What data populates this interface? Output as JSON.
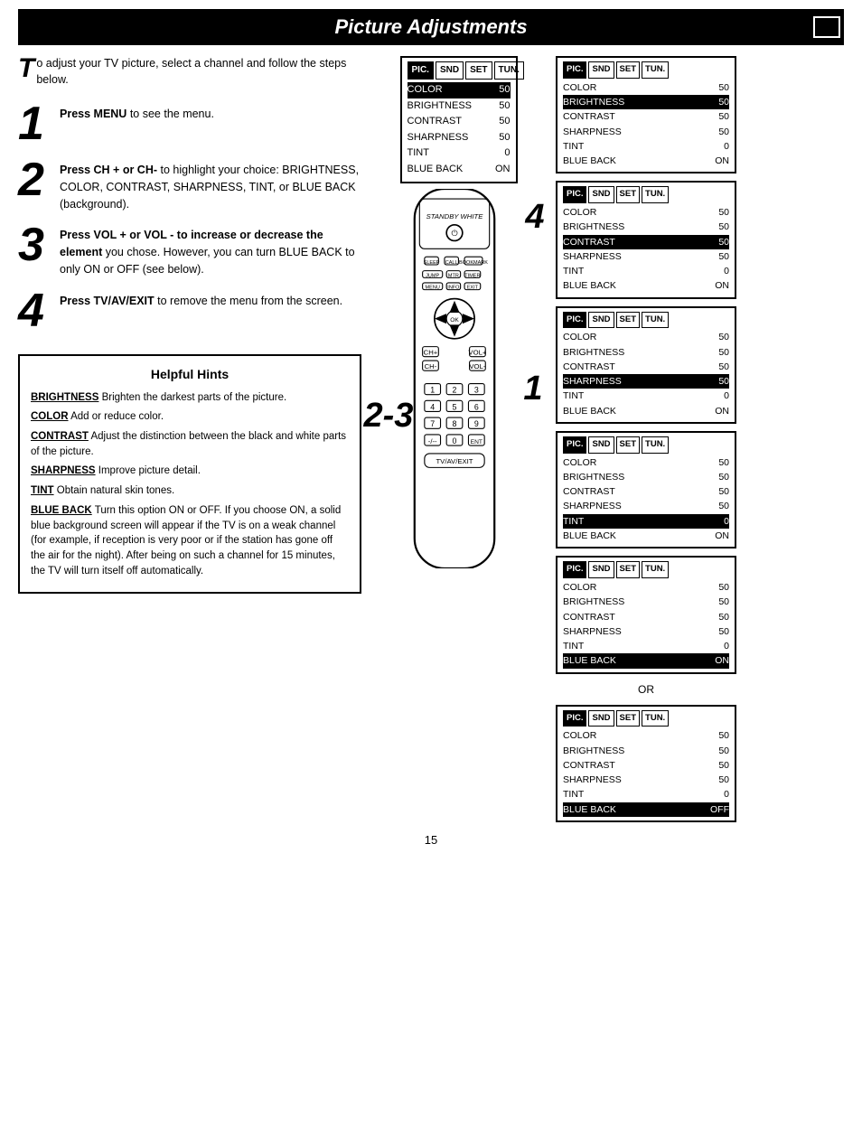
{
  "header": {
    "title": "Picture Adjustments"
  },
  "intro": {
    "text": "o adjust your TV picture, select a channel and follow the steps below."
  },
  "steps": [
    {
      "number": "1",
      "text_parts": [
        {
          "bold": true,
          "text": "Press MENU"
        },
        {
          "bold": false,
          "text": " to see the menu."
        }
      ]
    },
    {
      "number": "2",
      "text_parts": [
        {
          "bold": true,
          "text": "Press CH + or CH-"
        },
        {
          "bold": false,
          "text": " to highlight your choice: BRIGHTNESS, COLOR, CONTRAST, SHARPNESS, TINT, or BLUE BACK (background)."
        }
      ]
    },
    {
      "number": "3",
      "text_parts": [
        {
          "bold": true,
          "text": "Press VOL + or VOL - to increase or decrease the element"
        },
        {
          "bold": false,
          "text": " you chose. However, you can turn BLUE BACK to only ON or OFF (see below)."
        }
      ]
    },
    {
      "number": "4",
      "text_parts": [
        {
          "bold": true,
          "text": "Press TV/AV/EXIT"
        },
        {
          "bold": false,
          "text": " to remove the menu from the screen."
        }
      ]
    }
  ],
  "helpful_hints": {
    "title": "Helpful Hints",
    "items": [
      {
        "label": "BRIGHTNESS",
        "text": " Brighten the darkest parts of the picture."
      },
      {
        "label": "COLOR",
        "text": " Add or reduce color."
      },
      {
        "label": "CONTRAST",
        "text": " Adjust the distinction between the black and white parts of the picture."
      },
      {
        "label": "SHARPNESS",
        "text": " Improve picture detail."
      },
      {
        "label": "TINT",
        "text": " Obtain natural skin tones."
      },
      {
        "label": "BLUE BACK",
        "text": " Turn this option ON or OFF. If you choose ON, a solid blue background screen will appear if the TV is on a weak channel (for example, if reception is very poor or if the station has gone off the air for the night). After being on such a channel for 15 minutes, the TV will turn itself off automatically."
      }
    ]
  },
  "main_screen": {
    "tabs": [
      "PIC.",
      "SND",
      "SET",
      "TUN."
    ],
    "active_tab": 0,
    "rows": [
      {
        "label": "COLOR",
        "value": "50",
        "highlighted": true
      },
      {
        "label": "BRIGHTNESS",
        "value": "50",
        "highlighted": false
      },
      {
        "label": "CONTRAST",
        "value": "50",
        "highlighted": false
      },
      {
        "label": "SHARPNESS",
        "value": "50",
        "highlighted": false
      },
      {
        "label": "TINT",
        "value": "0",
        "highlighted": false
      },
      {
        "label": "BLUE BACK",
        "value": "ON",
        "highlighted": false
      }
    ]
  },
  "side_screens": [
    {
      "tabs": [
        "PIC.",
        "SND",
        "SET",
        "TUN."
      ],
      "active_tab": 0,
      "rows": [
        {
          "label": "COLOR",
          "value": "50",
          "highlighted": false
        },
        {
          "label": "BRIGHTNESS",
          "value": "50",
          "highlighted": true
        },
        {
          "label": "CONTRAST",
          "value": "50",
          "highlighted": false
        },
        {
          "label": "SHARPNESS",
          "value": "50",
          "highlighted": false
        },
        {
          "label": "TINT",
          "value": "0",
          "highlighted": false
        },
        {
          "label": "BLUE BACK",
          "value": "ON",
          "highlighted": false
        }
      ]
    },
    {
      "tabs": [
        "PIC.",
        "SND",
        "SET",
        "TUN."
      ],
      "active_tab": 0,
      "rows": [
        {
          "label": "COLOR",
          "value": "50",
          "highlighted": false
        },
        {
          "label": "BRIGHTNESS",
          "value": "50",
          "highlighted": false
        },
        {
          "label": "CONTRAST",
          "value": "50",
          "highlighted": true
        },
        {
          "label": "SHARPNESS",
          "value": "50",
          "highlighted": false
        },
        {
          "label": "TINT",
          "value": "0",
          "highlighted": false
        },
        {
          "label": "BLUE BACK",
          "value": "ON",
          "highlighted": false
        }
      ]
    },
    {
      "tabs": [
        "PIC.",
        "SND",
        "SET",
        "TUN."
      ],
      "active_tab": 0,
      "rows": [
        {
          "label": "COLOR",
          "value": "50",
          "highlighted": false
        },
        {
          "label": "BRIGHTNESS",
          "value": "50",
          "highlighted": false
        },
        {
          "label": "CONTRAST",
          "value": "50",
          "highlighted": false
        },
        {
          "label": "SHARPNESS",
          "value": "50",
          "highlighted": true
        },
        {
          "label": "TINT",
          "value": "0",
          "highlighted": false
        },
        {
          "label": "BLUE BACK",
          "value": "ON",
          "highlighted": false
        }
      ]
    },
    {
      "tabs": [
        "PIC.",
        "SND",
        "SET",
        "TUN."
      ],
      "active_tab": 0,
      "rows": [
        {
          "label": "COLOR",
          "value": "50",
          "highlighted": false
        },
        {
          "label": "BRIGHTNESS",
          "value": "50",
          "highlighted": false
        },
        {
          "label": "CONTRAST",
          "value": "50",
          "highlighted": false
        },
        {
          "label": "SHARPNESS",
          "value": "50",
          "highlighted": false
        },
        {
          "label": "TINT",
          "value": "0",
          "highlighted": true
        },
        {
          "label": "BLUE BACK",
          "value": "ON",
          "highlighted": false
        }
      ]
    },
    {
      "tabs": [
        "PIC.",
        "SND",
        "SET",
        "TUN."
      ],
      "active_tab": 0,
      "rows": [
        {
          "label": "COLOR",
          "value": "50",
          "highlighted": false
        },
        {
          "label": "BRIGHTNESS",
          "value": "50",
          "highlighted": false
        },
        {
          "label": "CONTRAST",
          "value": "50",
          "highlighted": false
        },
        {
          "label": "SHARPNESS",
          "value": "50",
          "highlighted": false
        },
        {
          "label": "TINT",
          "value": "0",
          "highlighted": false
        },
        {
          "label": "BLUE BACK",
          "value": "ON",
          "highlighted": true
        }
      ]
    },
    {
      "tabs": [
        "PIC.",
        "SND",
        "SET",
        "TUN."
      ],
      "active_tab": 0,
      "rows": [
        {
          "label": "COLOR",
          "value": "50",
          "highlighted": false
        },
        {
          "label": "BRIGHTNESS",
          "value": "50",
          "highlighted": false
        },
        {
          "label": "CONTRAST",
          "value": "50",
          "highlighted": false
        },
        {
          "label": "SHARPNESS",
          "value": "50",
          "highlighted": false
        },
        {
          "label": "TINT",
          "value": "0",
          "highlighted": false
        },
        {
          "label": "BLUE BACK",
          "value": "OFF",
          "highlighted": true
        }
      ]
    }
  ],
  "or_label": "OR",
  "page_number": "15"
}
